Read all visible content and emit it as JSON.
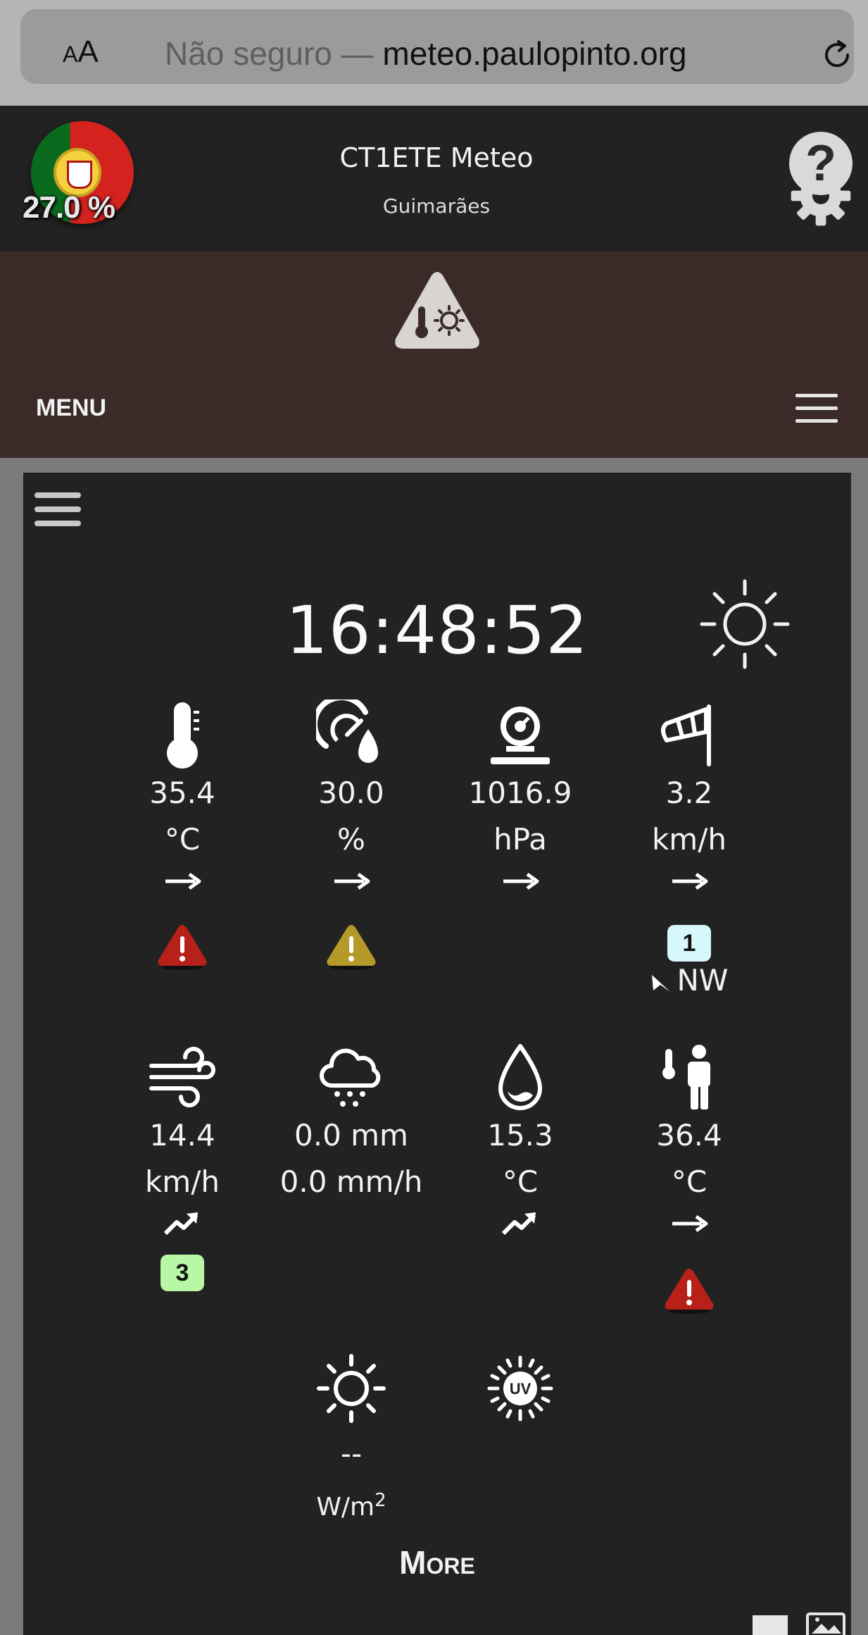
{
  "browser": {
    "aa_small": "A",
    "aa_large": "A",
    "insecure_label": "Não seguro — ",
    "host": "meteo.paulopinto.org",
    "reload_icon": "reload-icon"
  },
  "header": {
    "flag_icon": "portugal-flag-icon",
    "percent": "27.0 %",
    "title": "CT1ETE Meteo",
    "location": "Guimarães",
    "settings_icon": "gear-icon",
    "help_label": "?"
  },
  "menu_band": {
    "alert_icon": "heat-warning-triangle-icon",
    "menu_label": "MENU",
    "burger_icon": "hamburger-icon"
  },
  "panel": {
    "burger_icon": "hamburger-icon",
    "time": "16:48:52",
    "condition_icon": "sun-icon",
    "temperature": {
      "value": "35.4",
      "unit": "°C",
      "trend": "→",
      "alert_color": "#b8201a"
    },
    "humidity": {
      "value": "30.0",
      "unit": "%",
      "trend": "→",
      "alert_color": "#b59a2a"
    },
    "pressure": {
      "value": "1016.9",
      "unit": "hPa",
      "trend": "→"
    },
    "wind": {
      "value": "3.2",
      "unit": "km/h",
      "trend": "→",
      "beaufort": "1",
      "beaufort_color": "#d6f7fb",
      "direction": "NW"
    },
    "gust": {
      "value": "14.4",
      "unit": "km/h",
      "trend": "↗",
      "beaufort": "3",
      "beaufort_color": "#b8f7a5"
    },
    "rain": {
      "total": "0.0 mm",
      "rate": "0.0 mm/h"
    },
    "dewpoint": {
      "value": "15.3",
      "unit": "°C",
      "trend": "↗"
    },
    "feels_like": {
      "value": "36.4",
      "unit": "°C",
      "trend": "→",
      "alert_color": "#b8201a"
    },
    "solar": {
      "value": "--",
      "unit_base": "W/m",
      "unit_sup": "2"
    },
    "uv": {
      "icon_label": "UV"
    },
    "more_label": "More"
  }
}
